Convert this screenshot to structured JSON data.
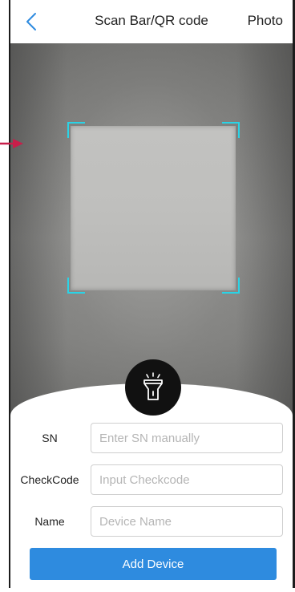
{
  "header": {
    "title": "Scan Bar/QR code",
    "photo_label": "Photo"
  },
  "form": {
    "sn": {
      "label": "SN",
      "placeholder": "Enter SN manually"
    },
    "checkcode": {
      "label": "CheckCode",
      "placeholder": "Input Checkcode"
    },
    "name": {
      "label": "Name",
      "placeholder": "Device Name"
    }
  },
  "add_button": "Add Device",
  "icons": {
    "back": "chevron-left-icon",
    "flashlight": "flashlight-icon",
    "arrow": "arrow-right-icon"
  },
  "colors": {
    "accent": "#2e8bdf",
    "scan_frame": "#2ad3e6",
    "back_chevron": "#2e8bdf",
    "arrow": "#c81e4a"
  }
}
